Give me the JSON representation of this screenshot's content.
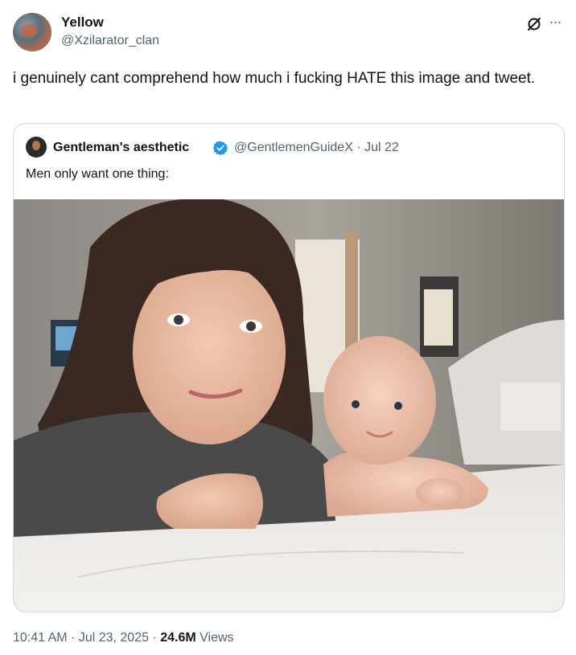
{
  "author": {
    "name": "Yellow",
    "handle": "@Xzilarator_clan"
  },
  "tweet": {
    "text": "i genuinely cant comprehend how much i fucking HATE this image and tweet."
  },
  "icons": {
    "grok": "grok-icon",
    "more": "more-icon",
    "verified": "verified-icon"
  },
  "quoted": {
    "name": "Gentleman's aesthetic",
    "handle_and_date": "@GentlemenGuideX · Jul 22",
    "text": "Men only want one thing:",
    "verified_color": "#1d9bf0"
  },
  "footer": {
    "time_date": "10:41 AM · Jul 23, 2025 · ",
    "views_count": "24.6M",
    "views_label": " Views"
  },
  "colors": {
    "text": "#0f1419",
    "secondary": "#536471",
    "border": "#cfd9de"
  }
}
